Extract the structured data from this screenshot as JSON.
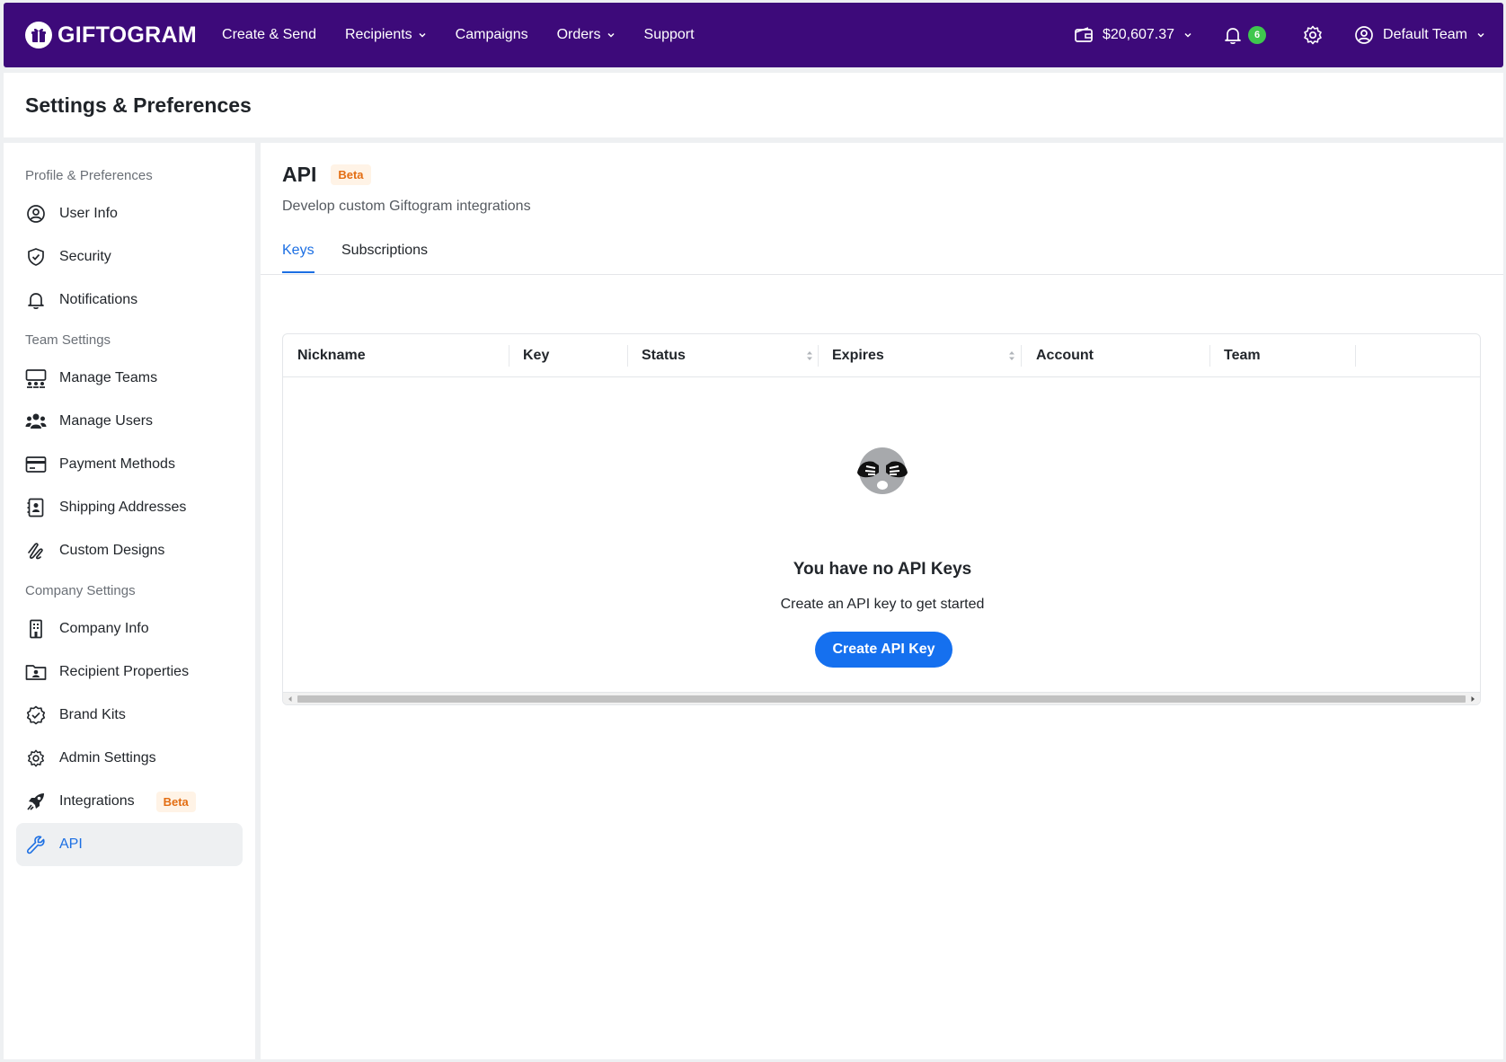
{
  "nav": {
    "brand": "GIFTOGRAM",
    "links": [
      {
        "label": "Create & Send",
        "dropdown": false
      },
      {
        "label": "Recipients",
        "dropdown": true
      },
      {
        "label": "Campaigns",
        "dropdown": false
      },
      {
        "label": "Orders",
        "dropdown": true
      },
      {
        "label": "Support",
        "dropdown": false
      }
    ],
    "balance": "$20,607.37",
    "notification_count": "6",
    "team": "Default Team"
  },
  "page": {
    "title": "Settings & Preferences"
  },
  "sidebar": {
    "sections": [
      {
        "title": "Profile & Preferences",
        "items": [
          {
            "label": "User Info",
            "icon": "user-circle-icon"
          },
          {
            "label": "Security",
            "icon": "shield-check-icon"
          },
          {
            "label": "Notifications",
            "icon": "bell-icon"
          }
        ]
      },
      {
        "title": "Team Settings",
        "items": [
          {
            "label": "Manage Teams",
            "icon": "teams-icon"
          },
          {
            "label": "Manage Users",
            "icon": "users-icon"
          },
          {
            "label": "Payment Methods",
            "icon": "credit-card-icon"
          },
          {
            "label": "Shipping Addresses",
            "icon": "address-book-icon"
          },
          {
            "label": "Custom Designs",
            "icon": "scribble-icon"
          }
        ]
      },
      {
        "title": "Company Settings",
        "items": [
          {
            "label": "Company Info",
            "icon": "building-icon"
          },
          {
            "label": "Recipient Properties",
            "icon": "folder-user-icon"
          },
          {
            "label": "Brand Kits",
            "icon": "badge-check-icon"
          },
          {
            "label": "Admin Settings",
            "icon": "gear-icon"
          },
          {
            "label": "Integrations",
            "icon": "rocket-icon",
            "badge": "Beta"
          },
          {
            "label": "API",
            "icon": "wrench-icon",
            "active": true
          }
        ]
      }
    ]
  },
  "main": {
    "title": "API",
    "badge": "Beta",
    "subtitle": "Develop custom Giftogram integrations",
    "tabs": [
      {
        "label": "Keys",
        "active": true
      },
      {
        "label": "Subscriptions",
        "active": false
      }
    ],
    "table": {
      "columns": [
        "Nickname",
        "Key",
        "Status",
        "Expires",
        "Account",
        "Team"
      ],
      "rows": []
    },
    "empty": {
      "title": "You have no API Keys",
      "subtitle": "Create an API key to get started",
      "button": "Create API Key"
    }
  },
  "colors": {
    "nav_bg": "#3d0a7a",
    "accent": "#1570ef",
    "badge_green": "#3fc74e",
    "beta_orange": "#e36d12"
  }
}
